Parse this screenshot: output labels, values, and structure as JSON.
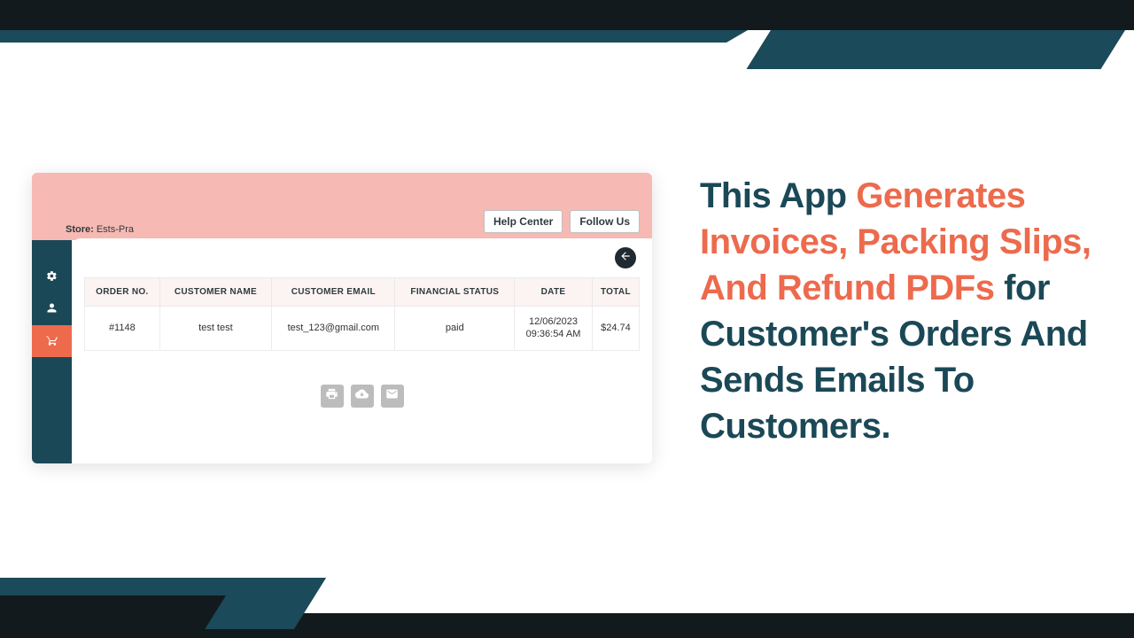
{
  "store": {
    "label": "Store:",
    "name": "Ests-Pra"
  },
  "header_buttons": {
    "help": "Help Center",
    "follow": "Follow Us"
  },
  "table": {
    "headers": {
      "order_no": "ORDER NO.",
      "customer_name": "CUSTOMER NAME",
      "customer_email": "CUSTOMER EMAIL",
      "financial_status": "FINANCIAL STATUS",
      "date": "DATE",
      "total": "TOTAL"
    },
    "row": {
      "order_no": "#1148",
      "customer_name": "test test",
      "customer_email": "test_123@gmail.com",
      "financial_status": "paid",
      "date_line1": "12/06/2023",
      "date_line2": "09:36:54 AM",
      "total": "$24.74"
    }
  },
  "marketing": {
    "part1": "This App ",
    "accent": "Generates Invoices, Packing Slips, And Refund PDFs",
    "part2": " for Customer's Orders And Sends Emails To Customers."
  }
}
